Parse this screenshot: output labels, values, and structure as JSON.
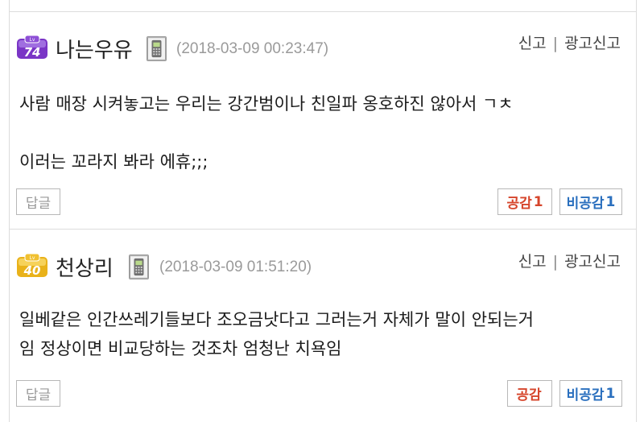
{
  "comments": [
    {
      "level": "74",
      "level_prefix": "Lv",
      "nickname": "나는우유",
      "date": "(2018-03-09 00:23:47)",
      "report": "신고",
      "ad_report": "광고신고",
      "separator": "|",
      "lines": [
        "사람 매장 시켜놓고는 우리는 강간범이나 친일파 옹호하진 않아서 ㄱㅊ",
        "",
        "이러는 꼬라지 봐라 에휴;;;"
      ],
      "reply_label": "답글",
      "like_label": "공감",
      "like_count": "1",
      "dislike_label": "비공감",
      "dislike_count": "1",
      "badge_color": "#7a35c6",
      "device_icon": "mobile-phone-icon"
    },
    {
      "level": "40",
      "level_prefix": "Lv",
      "nickname": "천상리",
      "date": "(2018-03-09 01:51:20)",
      "report": "신고",
      "ad_report": "광고신고",
      "separator": "|",
      "lines": [
        "일베같은 인간쓰레기들보다 조오금낫다고 그러는거 자체가 말이 안되는거",
        "임 정상이면 비교당하는 것조차 엄청난 치욕임"
      ],
      "reply_label": "답글",
      "like_label": "공감",
      "like_count": "",
      "dislike_label": "비공감",
      "dislike_count": "1",
      "badge_color": "#e9b21a",
      "device_icon": "mobile-phone-icon"
    }
  ]
}
